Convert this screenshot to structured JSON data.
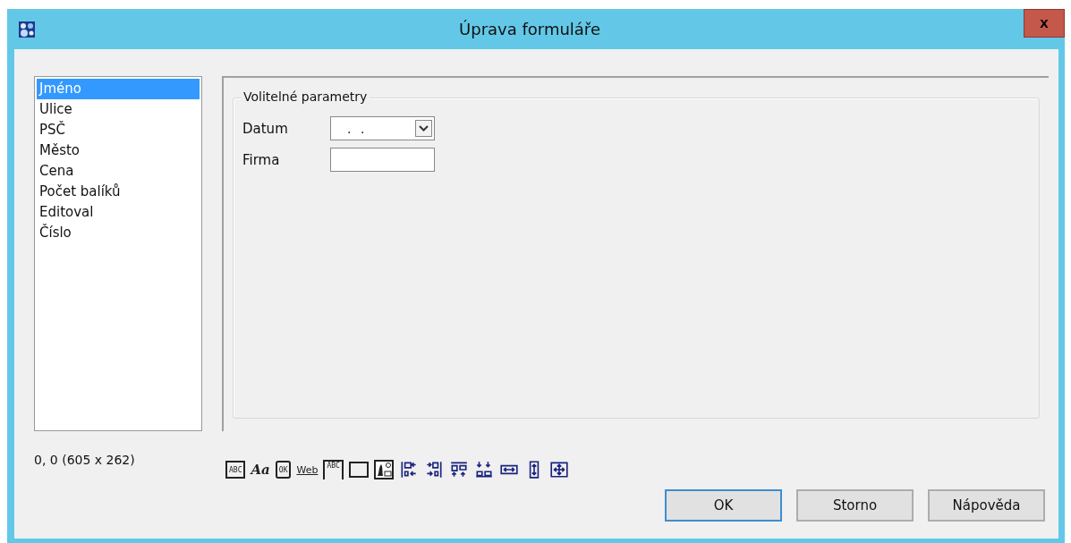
{
  "window": {
    "title": "Úprava formuláře",
    "close": "x"
  },
  "fields": [
    {
      "label": "Jméno",
      "selected": true
    },
    {
      "label": "Ulice",
      "selected": false
    },
    {
      "label": "PSČ",
      "selected": false
    },
    {
      "label": "Město",
      "selected": false
    },
    {
      "label": "Cena",
      "selected": false
    },
    {
      "label": "Počet balíků",
      "selected": false
    },
    {
      "label": "Editoval",
      "selected": false
    },
    {
      "label": "Číslo",
      "selected": false
    }
  ],
  "group": {
    "title": "Volitelné parametry",
    "rows": [
      {
        "kind": "date",
        "label": "Datum",
        "value": ". ."
      },
      {
        "kind": "text",
        "label": "Firma"
      }
    ]
  },
  "position": "0, 0  (605 x 262)",
  "toolbar": [
    {
      "kind": "label",
      "text": "ABC"
    },
    {
      "kind": "font",
      "text": "Aa"
    },
    {
      "kind": "button",
      "text": "OK"
    },
    {
      "kind": "link",
      "text": "Web"
    },
    {
      "kind": "group",
      "text": "ABC"
    },
    {
      "kind": "frame"
    },
    {
      "kind": "image"
    },
    {
      "kind": "align-left"
    },
    {
      "kind": "align-right"
    },
    {
      "kind": "align-top"
    },
    {
      "kind": "align-bottom"
    },
    {
      "kind": "same-width"
    },
    {
      "kind": "same-height"
    },
    {
      "kind": "same-size"
    }
  ],
  "buttons": [
    {
      "label": "OK",
      "default": true
    },
    {
      "label": "Storno",
      "default": false
    },
    {
      "label": "Nápověda",
      "default": false
    }
  ]
}
